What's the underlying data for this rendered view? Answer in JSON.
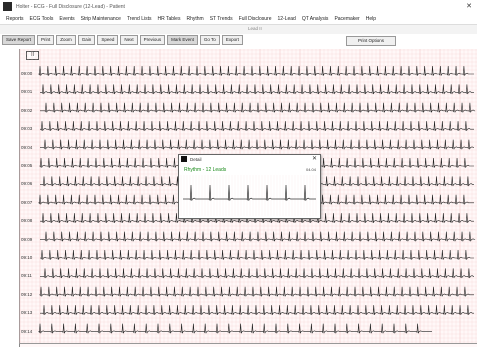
{
  "window": {
    "title": "Holter - ECG - Full Disclosure (12-Lead) - Patient"
  },
  "menu": {
    "items": [
      "Reports",
      "ECG Tools",
      "Events",
      "Strip Maintenance",
      "Trend Lists",
      "HR Tables",
      "Rhythm",
      "ST Trends",
      "Full Disclosure",
      "12-Lead",
      "QT Analysis",
      "Pacemaker",
      "Help"
    ]
  },
  "toolbar_strip": {
    "label": "Lead II"
  },
  "toolbar": {
    "buttons": [
      "Save Report",
      "Print",
      "Zoom",
      "Gain",
      "Speed",
      "Next",
      "Previous",
      "Mark Event",
      "Go To",
      "Export"
    ],
    "wide_button": "Print Options"
  },
  "ecg": {
    "lead_tag": "II",
    "time_labels": [
      "09:00",
      "09:01",
      "09:02",
      "09:03",
      "09:04",
      "09:05",
      "09:06",
      "09:07",
      "09:08",
      "09:09",
      "09:10",
      "09:11",
      "09:12",
      "09:13",
      "09:14"
    ],
    "grid_color": "#f3c9c9",
    "trace_color": "#222222"
  },
  "popup": {
    "title": "Detail",
    "lead_label": "Rhythm - 12 Leads",
    "value": "04.04"
  }
}
